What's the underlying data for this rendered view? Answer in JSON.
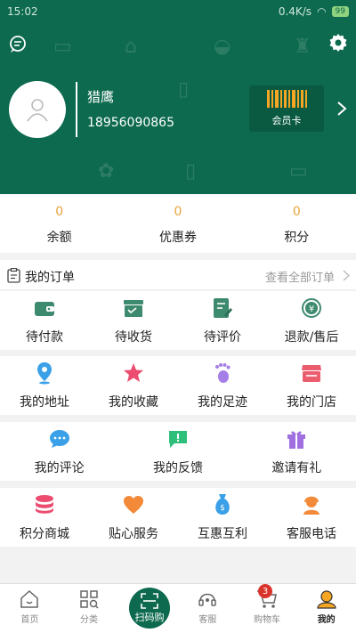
{
  "statusbar": {
    "time": "15:02",
    "network_speed": "0.4K/s",
    "battery": "99"
  },
  "profile": {
    "username": "猎鹰",
    "phone": "18956090865",
    "member_card_label": "会员卡"
  },
  "stats": [
    {
      "value": "0",
      "label": "余额"
    },
    {
      "value": "0",
      "label": "优惠券"
    },
    {
      "value": "0",
      "label": "积分"
    }
  ],
  "orders": {
    "title": "我的订单",
    "view_all": "查看全部订单",
    "items": [
      {
        "label": "待付款",
        "icon": "wallet-icon"
      },
      {
        "label": "待收货",
        "icon": "box-icon"
      },
      {
        "label": "待评价",
        "icon": "review-icon"
      },
      {
        "label": "退款/售后",
        "icon": "refund-icon"
      }
    ]
  },
  "row2": [
    {
      "label": "我的地址",
      "icon": "location-pin-icon",
      "color": "#3aa0e8"
    },
    {
      "label": "我的收藏",
      "icon": "star-icon",
      "color": "#ec4c6f"
    },
    {
      "label": "我的足迹",
      "icon": "footprint-icon",
      "color": "#a57ee8"
    },
    {
      "label": "我的门店",
      "icon": "store-icon",
      "color": "#ec5c6f"
    }
  ],
  "row3": [
    {
      "label": "我的评论",
      "icon": "comment-icon",
      "color": "#3aa0e8"
    },
    {
      "label": "我的反馈",
      "icon": "feedback-icon",
      "color": "#2ebf7a"
    },
    {
      "label": "邀请有礼",
      "icon": "gift-icon",
      "color": "#a070e0"
    }
  ],
  "row4": [
    {
      "label": "积分商城",
      "icon": "coins-icon",
      "color": "#ec4c6f"
    },
    {
      "label": "贴心服务",
      "icon": "heart-icon",
      "color": "#f28a3a"
    },
    {
      "label": "互惠互利",
      "icon": "money-bag-icon",
      "color": "#3aa0e8"
    },
    {
      "label": "客服电话",
      "icon": "agent-icon",
      "color": "#f28a3a"
    }
  ],
  "bottom_nav": [
    {
      "label": "首页"
    },
    {
      "label": "分类"
    },
    {
      "label": "扫码购"
    },
    {
      "label": "客服"
    },
    {
      "label": "购物车",
      "badge": "3"
    },
    {
      "label": "我的"
    }
  ],
  "colors": {
    "brand": "#0d6a4e",
    "accent": "#e8a43a"
  }
}
